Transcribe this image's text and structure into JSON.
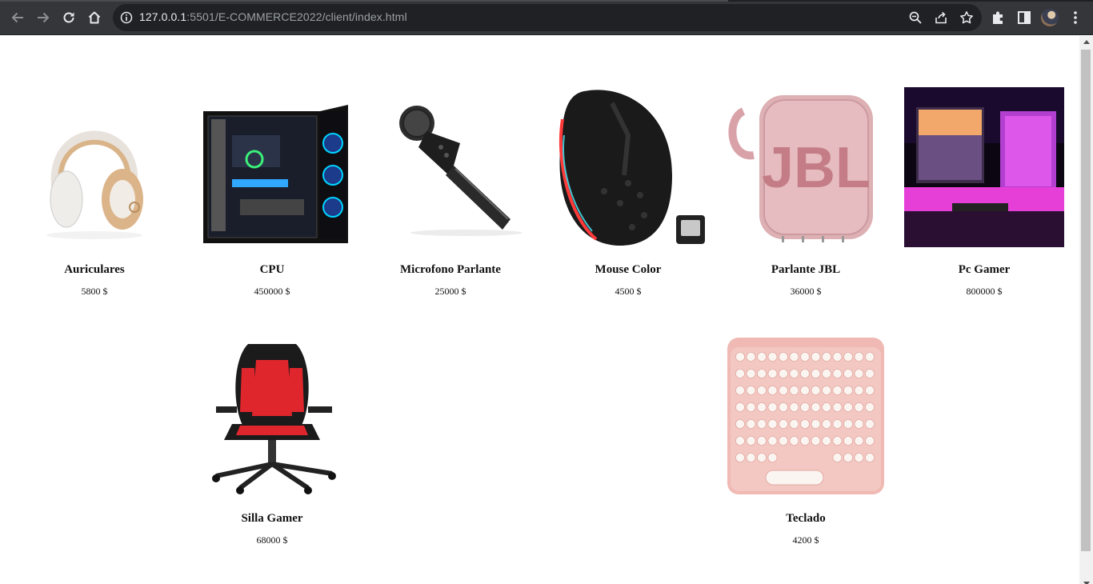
{
  "browser": {
    "url_host": "127.0.0.1",
    "url_rest": ":5501/E-COMMERCE2022/client/index.html",
    "icons": {
      "back": "back-arrow-icon",
      "forward": "forward-arrow-icon",
      "reload": "reload-icon",
      "home": "home-icon",
      "info": "info-icon",
      "zoom": "zoom-icon",
      "share": "share-icon",
      "bookmark": "star-icon",
      "extensions": "puzzle-icon",
      "sidepanel": "side-panel-icon",
      "menu": "kebab-menu-icon"
    }
  },
  "products": [
    {
      "name": "Auriculares",
      "price": "5800 $"
    },
    {
      "name": "CPU",
      "price": "450000 $"
    },
    {
      "name": "Microfono Parlante",
      "price": "25000 $"
    },
    {
      "name": "Mouse Color",
      "price": "4500 $"
    },
    {
      "name": "Parlante JBL",
      "price": "36000 $"
    },
    {
      "name": "Pc Gamer",
      "price": "800000 $"
    },
    {
      "name": "Silla Gamer",
      "price": "68000 $"
    },
    {
      "name": "Teclado",
      "price": "4200 $"
    }
  ],
  "logo_texts": {
    "speaker_brand": "JBL"
  },
  "colors": {
    "chrome_bg": "#35363a",
    "omnibox_bg": "#202124",
    "text": "#111111",
    "page_bg": "#ffffff"
  }
}
